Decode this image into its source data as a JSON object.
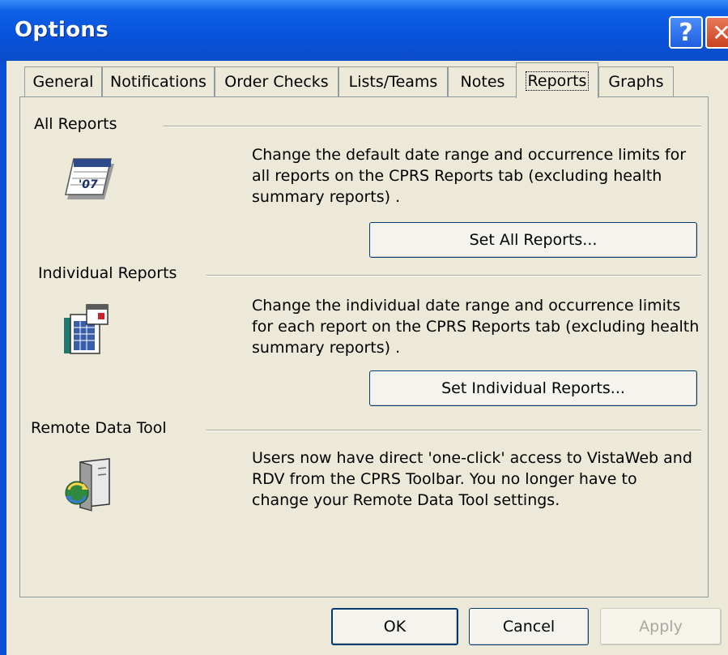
{
  "window": {
    "title": "Options",
    "help_glyph": "?",
    "close_glyph": "✕"
  },
  "tabs": [
    {
      "label": "General",
      "active": false
    },
    {
      "label": "Notifications",
      "active": false
    },
    {
      "label": "Order Checks",
      "active": false
    },
    {
      "label": "Lists/Teams",
      "active": false
    },
    {
      "label": "Notes",
      "active": false
    },
    {
      "label": "Reports",
      "active": true
    },
    {
      "label": "Graphs",
      "active": false
    }
  ],
  "sections": {
    "all_reports": {
      "title": "All Reports",
      "icon": "calendar-report-icon",
      "description": "Change the default date range and occurrence limits for all reports on the CPRS Reports tab (excluding health summary reports) .",
      "button": "Set All Reports..."
    },
    "individual_reports": {
      "title": "Individual Reports",
      "icon": "report-sheet-icon",
      "description": "Change the individual date range and occurrence limits for each report on the CPRS Reports tab (excluding health summary reports) .",
      "button": "Set Individual Reports..."
    },
    "remote_data_tool": {
      "title": "Remote Data Tool",
      "icon": "remote-data-icon",
      "description": "Users now have direct 'one-click' access to VistaWeb and RDV from the CPRS Toolbar.  You no longer have to change your Remote Data Tool settings."
    }
  },
  "footer": {
    "ok": "OK",
    "cancel": "Cancel",
    "apply": "Apply"
  }
}
